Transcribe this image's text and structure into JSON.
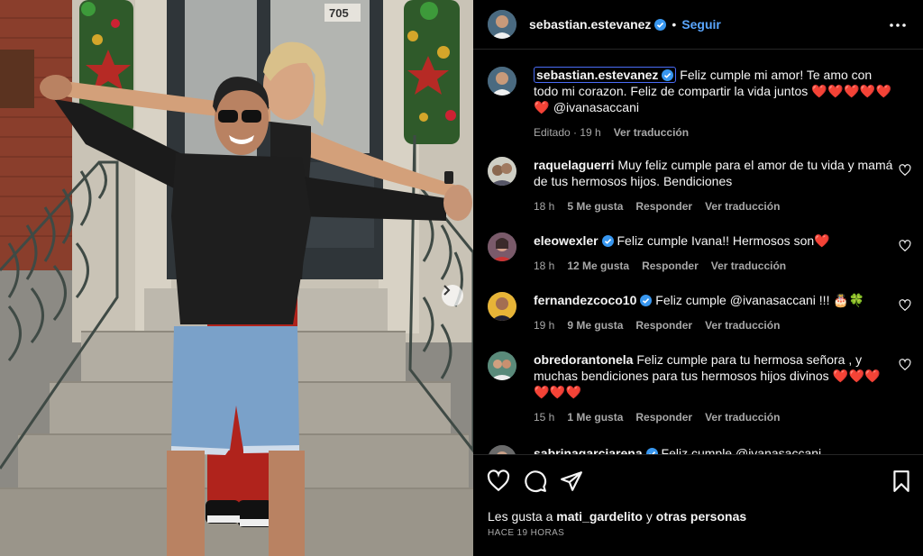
{
  "header": {
    "username": "sebastian.estevanez",
    "separator": "•",
    "follow_label": "Seguir"
  },
  "caption": {
    "username": "sebastian.estevanez",
    "text": "Feliz cumple mi amor! Te amo con todo mi corazon. Feliz de compartir la vida juntos",
    "hearts": "❤️❤️❤️❤️❤️",
    "hearts2": "❤️",
    "mention": "@ivanasaccani",
    "edited": "Editado · 19 h",
    "translate": "Ver traducción"
  },
  "comments": [
    {
      "username": "raquelaguerri",
      "verified": false,
      "text": "Muy feliz cumple para el amor de tu vida y mamá de tus hermosos hijos. Bendiciones",
      "time": "18 h",
      "likes": "5 Me gusta",
      "reply": "Responder",
      "translate": "Ver traducción"
    },
    {
      "username": "eleowexler",
      "verified": true,
      "text": "Feliz cumple Ivana!! Hermosos son",
      "emoji": "❤️",
      "time": "18 h",
      "likes": "12 Me gusta",
      "reply": "Responder",
      "translate": "Ver traducción"
    },
    {
      "username": "fernandezcoco10",
      "verified": true,
      "text": "Feliz cumple",
      "mention": "@ivanasaccani",
      "extra": "!!! 🎂🍀",
      "time": "19 h",
      "likes": "9 Me gusta",
      "reply": "Responder",
      "translate": "Ver traducción"
    },
    {
      "username": "obredorantonela",
      "verified": false,
      "text": "Feliz cumple para tu hermosa señora , y muchas bendiciones para tus hermosos hijos divinos",
      "emoji": "❤️❤️❤️",
      "emoji2": "❤️❤️❤️",
      "time": "15 h",
      "likes": "1 Me gusta",
      "reply": "Responder",
      "translate": "Ver traducción"
    },
    {
      "username": "sabrinagarciarena",
      "verified": true,
      "text": "Feliz cumple @ivanasaccani"
    }
  ],
  "likes": {
    "prefix": "Les gusta a",
    "user": "mati_gardelito",
    "conj": "y",
    "others": "otras personas"
  },
  "timestamp": "HACE 19 HORAS",
  "photo": {
    "house_number": "705"
  },
  "colors": {
    "accent": "#5aa6ff",
    "verified": "#3897f0",
    "heart": "#ff3040",
    "meta": "#a8a8a8",
    "background": "#000000"
  },
  "icons": [
    "heart-icon",
    "comment-icon",
    "share-icon",
    "bookmark-icon",
    "more-icon",
    "chevron-right-icon",
    "verified-icon"
  ]
}
